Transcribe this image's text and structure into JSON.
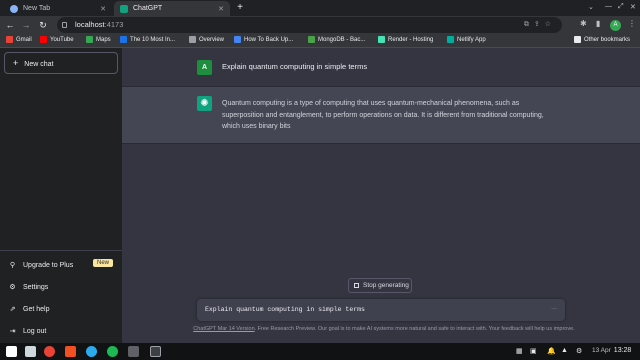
{
  "browser": {
    "tabs": [
      {
        "title": "New Tab"
      },
      {
        "title": "ChatGPT"
      }
    ],
    "url_host": "localhost",
    "url_port": ":4173",
    "profile_initial": "A",
    "bookmarks": [
      "Gmail",
      "YouTube",
      "Maps",
      "The 10 Most In...",
      "Overview",
      "How To Back Up...",
      "MongoDB - Bac...",
      "Render - Hosting",
      "Netlify App"
    ],
    "other_bookmarks": "Other bookmarks"
  },
  "sidebar": {
    "new_chat": "New chat",
    "items": [
      {
        "label": "Upgrade to Plus",
        "icon": "user-icon"
      },
      {
        "label": "Settings",
        "icon": "gear-icon"
      },
      {
        "label": "Get help",
        "icon": "external-link-icon"
      },
      {
        "label": "Log out",
        "icon": "logout-icon"
      }
    ],
    "badge": "New"
  },
  "conversation": {
    "user_avatar": "A",
    "user_message": "Explain quantum computing in simple terms",
    "assistant_message": "Quantum computing is a type of computing that uses quantum-mechanical phenomena, such as superposition and entanglement, to perform operations on data. It is different from traditional computing, which uses binary bits"
  },
  "composer": {
    "stop_button": "Stop generating",
    "input_value": "Explain quantum computing in simple terms",
    "dots": "..."
  },
  "footer": {
    "link": "ChatGPT Mar 14 Version",
    "text": ". Free Research Preview. Our goal is to make AI systems more natural and safe to interact with. Your feedback will help us improve."
  },
  "taskbar": {
    "date": "13 Apr",
    "time": "13:28"
  },
  "colors": {
    "sidebar_bg": "#202123",
    "main_bg": "#343541",
    "assistant_bg": "#444654",
    "accent": "#10a37f"
  }
}
